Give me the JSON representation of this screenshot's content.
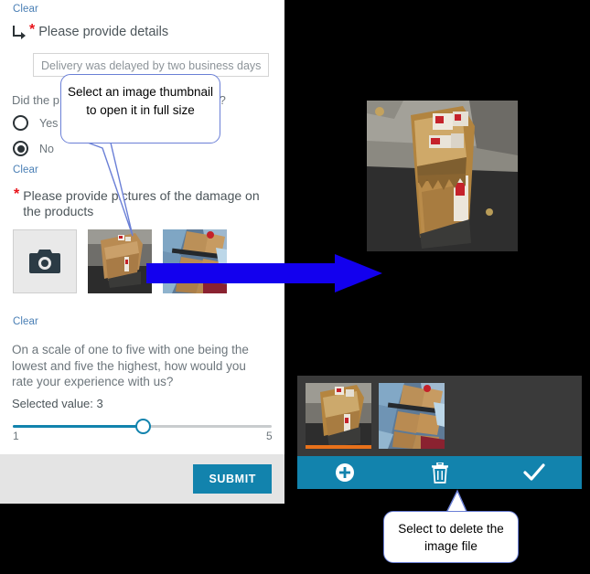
{
  "form": {
    "clear_label": "Clear",
    "details_question": "Please provide details",
    "details_input_value": "Delivery was delayed by two business days",
    "radio_question": "Did the p                        tion?",
    "radio_question_left": "Did the p",
    "radio_question_right": "tion?",
    "radio_options": [
      {
        "label": "Yes",
        "selected": false
      },
      {
        "label": "No",
        "selected": true
      }
    ],
    "pictures_question": "Please provide pictures of the damage on the products",
    "camera_icon": "camera-icon",
    "required_marker": "*",
    "rating_question": "On a scale of one to five with one being the lowest and five the highest, how would you rate your experience with us?",
    "selected_value_label": "Selected value: 3",
    "slider": {
      "min": "1",
      "max": "5",
      "value": 3,
      "percent": 50
    },
    "submit_label": "SUBMIT"
  },
  "viewer": {
    "toolbar": [
      {
        "name": "add-image-button",
        "icon": "plus-circle-icon"
      },
      {
        "name": "delete-image-button",
        "icon": "trash-icon"
      },
      {
        "name": "confirm-button",
        "icon": "checkmark-icon"
      }
    ],
    "thumbnails": [
      {
        "name": "strip-thumbnail-1",
        "selected": true
      },
      {
        "name": "strip-thumbnail-2",
        "selected": false
      }
    ]
  },
  "callouts": {
    "top": "Select an image thumbnail to open it in full size",
    "bottom": "Select to delete the image file"
  },
  "colors": {
    "accent_blue": "#1283ad",
    "link_blue": "#4a7fb5",
    "required_red": "#e8131a",
    "callout_border": "#6a7fd6",
    "arrow_blue": "#1300ee",
    "selection_orange": "#e8711a",
    "strip_bg": "#3a3a3a",
    "footer_bg": "#e4e4e4"
  }
}
